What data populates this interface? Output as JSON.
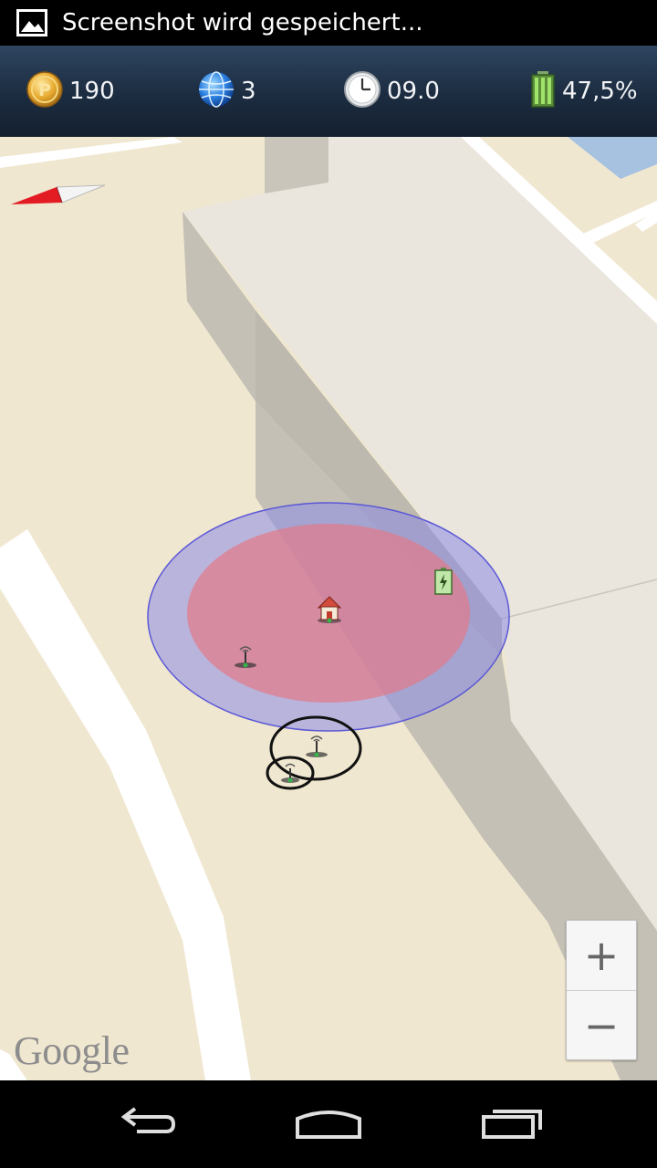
{
  "status_bar": {
    "notification_text": "Screenshot wird gespeichert...",
    "notification_icon": "image-icon"
  },
  "hud": {
    "points": "190",
    "globe": "3",
    "clock": "09.0",
    "battery": "47,5%"
  },
  "map": {
    "attribution": "Google",
    "zoom_in_label": "+",
    "zoom_out_label": "−",
    "markers": [
      "house-icon",
      "battery-charging-icon",
      "antenna-icon",
      "antenna-icon",
      "antenna-icon"
    ],
    "colors": {
      "ground": "#f0e7d0",
      "road": "#ffffff",
      "building_roof": "#eae6dd",
      "building_wall": "#bfbbb0",
      "outer_zone": "#a3a0e8",
      "inner_zone": "#e08a96",
      "water": "#a6c2e0"
    }
  },
  "nav_bar": {
    "back": "back-icon",
    "home": "home-icon",
    "recents": "recent-apps-icon"
  }
}
